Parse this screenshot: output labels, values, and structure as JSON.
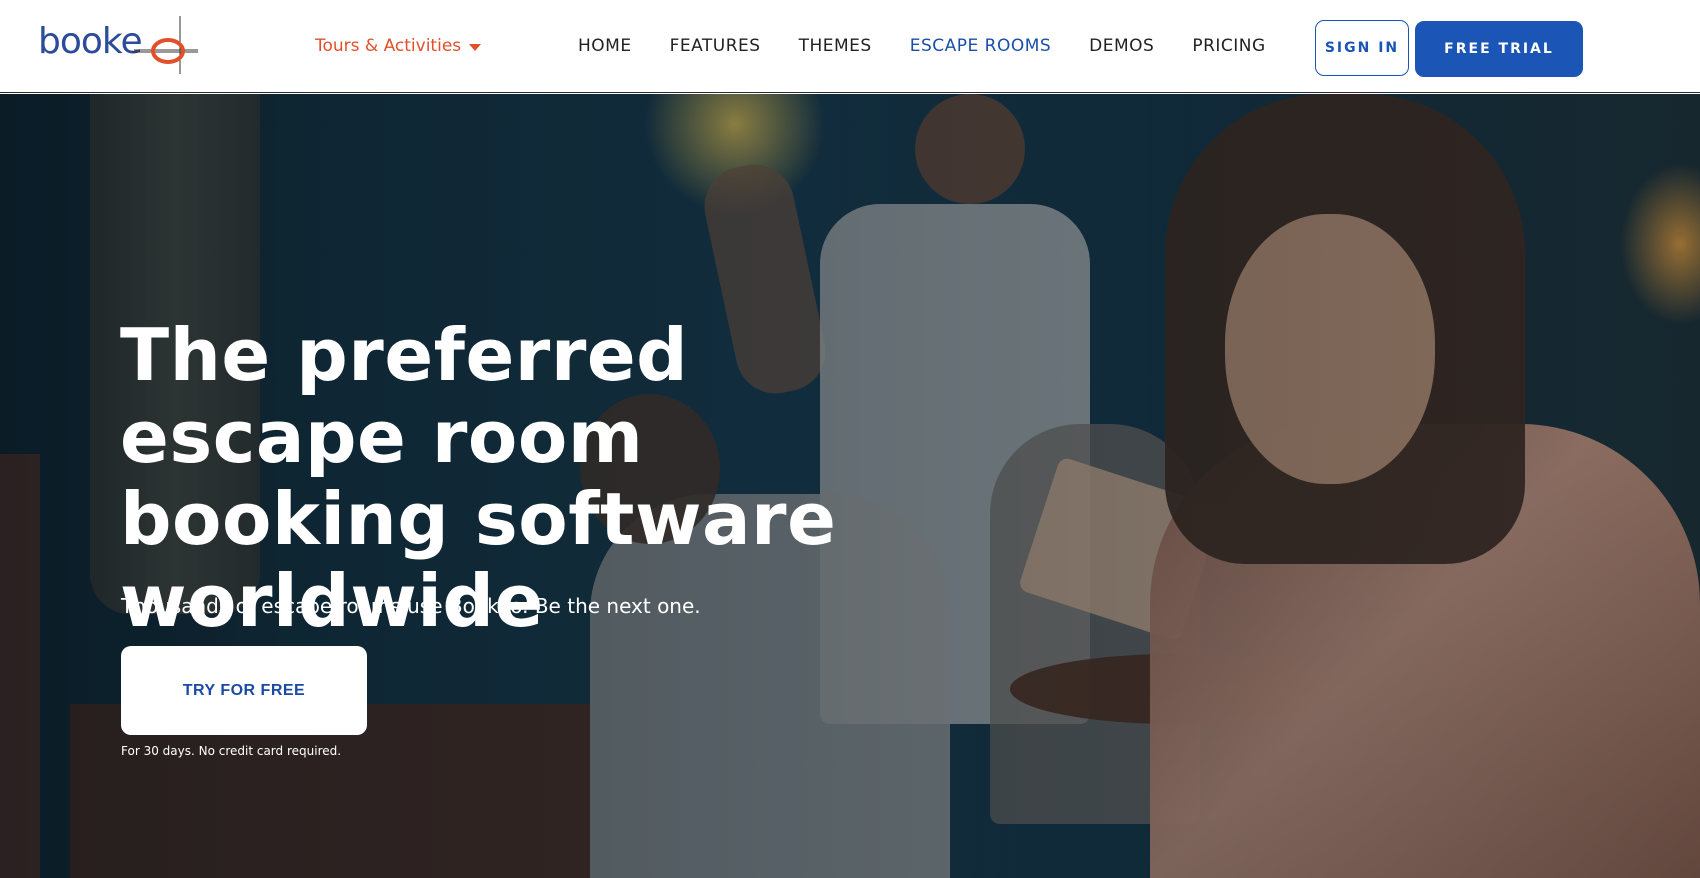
{
  "brand": {
    "logo_text": "booke",
    "logo_color": "#2a4c9a",
    "logo_mark_color": "#e2502a",
    "logo_icon": "crosshair-o-icon"
  },
  "header": {
    "tours_menu": {
      "label": "Tours & Activities",
      "icon": "caret-down-icon"
    },
    "nav": [
      {
        "label": "HOME",
        "active": false
      },
      {
        "label": "FEATURES",
        "active": false
      },
      {
        "label": "THEMES",
        "active": false
      },
      {
        "label": "ESCAPE ROOMS",
        "active": true
      },
      {
        "label": "DEMOS",
        "active": false
      },
      {
        "label": "PRICING",
        "active": false
      }
    ],
    "sign_in_label": "SIGN IN",
    "free_trial_label": "FREE TRIAL"
  },
  "hero": {
    "title": "The preferred escape room booking software worldwide",
    "subtitle": "Thousands of escape rooms use Bookeo. Be the next one.",
    "cta_label": "TRY FOR FREE",
    "note": "For 30 days. No credit card required."
  },
  "colors": {
    "accent_blue": "#1b55b5",
    "accent_orange": "#e2502a",
    "active_nav": "#1a4fa8"
  }
}
